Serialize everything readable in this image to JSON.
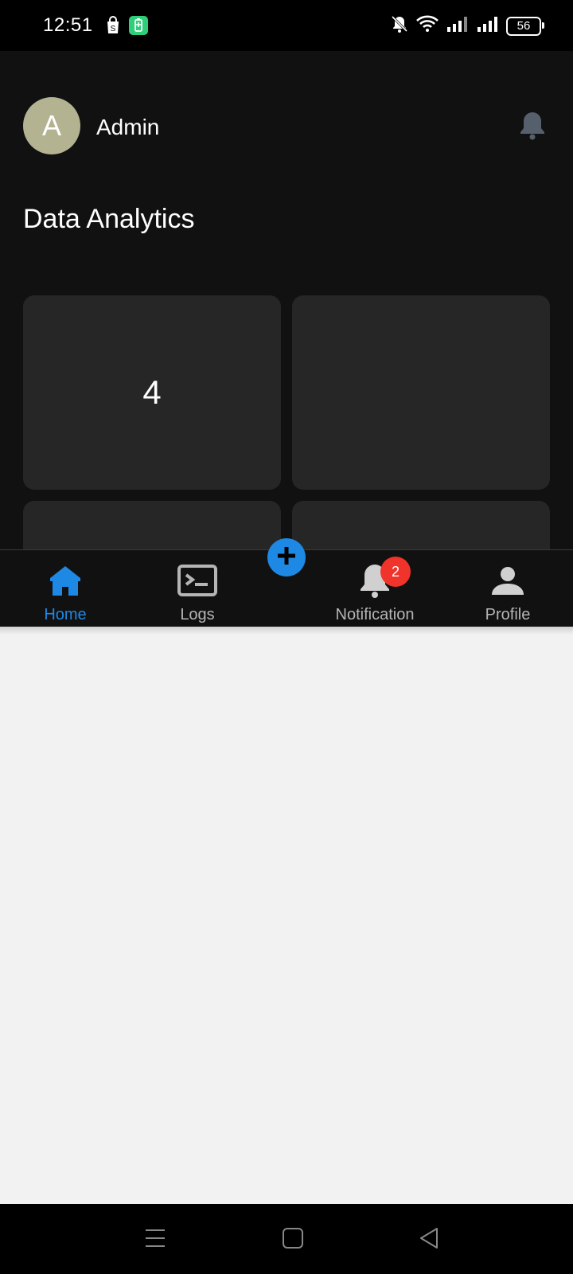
{
  "status_bar": {
    "time": "12:51",
    "battery_level": "56",
    "icons": [
      "shopping-bag-icon",
      "battery-saver-icon",
      "mute-icon",
      "wifi-icon",
      "signal-icon",
      "signal-icon",
      "battery-icon"
    ]
  },
  "header": {
    "avatar_initial": "A",
    "user_name": "Admin",
    "bell_icon": "bell-icon"
  },
  "main": {
    "section_title": "Data Analytics",
    "cards": [
      {
        "value": "4"
      },
      {
        "value": ""
      },
      {
        "value": ""
      },
      {
        "value": ""
      }
    ]
  },
  "bottom_nav": {
    "items": [
      {
        "label": "Home",
        "icon": "home-icon",
        "active": true
      },
      {
        "label": "Logs",
        "icon": "terminal-icon",
        "active": false
      },
      {
        "label": "Notification",
        "icon": "bell-icon",
        "badge": "2",
        "active": false
      },
      {
        "label": "Profile",
        "icon": "person-icon",
        "active": false
      }
    ],
    "fab_icon": "plus-icon"
  },
  "system_nav": {
    "buttons": [
      "menu-icon",
      "home-square-icon",
      "back-triangle-icon"
    ]
  },
  "colors": {
    "accent": "#1e88e5",
    "background": "#111111",
    "card": "#262626",
    "badge": "#f0332b",
    "avatar": "#b3b392"
  }
}
